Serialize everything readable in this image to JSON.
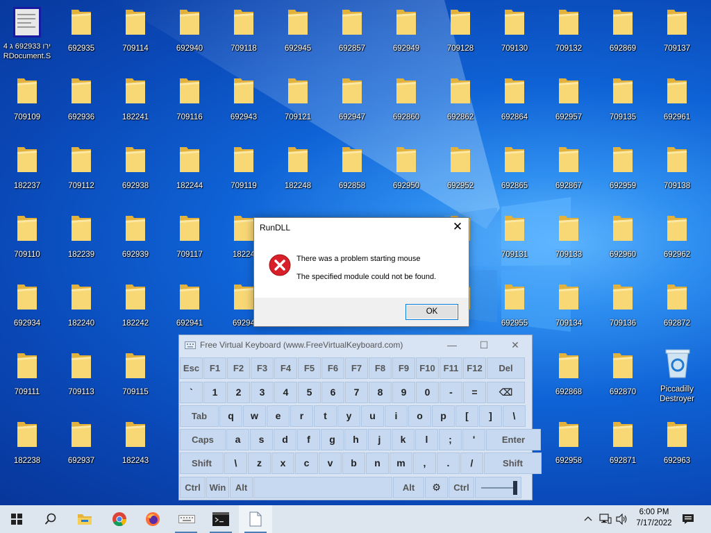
{
  "desktop": {
    "rows": [
      [
        "",
        "692935",
        "709114",
        "692940",
        "709118",
        "692945",
        "692857",
        "692949",
        "709128",
        "709130",
        "709132",
        "692869",
        "709137"
      ],
      [
        "709109",
        "692936",
        "182241",
        "709116",
        "692943",
        "709121",
        "692947",
        "692860",
        "692862",
        "692864",
        "692957",
        "709135",
        "692961"
      ],
      [
        "182237",
        "709112",
        "692938",
        "182244",
        "709119",
        "182248",
        "692858",
        "692950",
        "692952",
        "692865",
        "692867",
        "692959",
        "709138"
      ],
      [
        "709110",
        "182239",
        "692939",
        "709117",
        "18224",
        "",
        "",
        "",
        "3",
        "709131",
        "709133",
        "692960",
        "692962"
      ],
      [
        "692934",
        "182240",
        "182242",
        "692941",
        "69294",
        "",
        "",
        "",
        "9",
        "692955",
        "709134",
        "709136",
        "692872"
      ],
      [
        "709111",
        "709113",
        "709115",
        "",
        "",
        "",
        "",
        "",
        "",
        "",
        "692868",
        "692870",
        ""
      ],
      [
        "182238",
        "692937",
        "182243",
        "",
        "",
        "",
        "",
        "",
        "",
        "",
        "692958",
        "692871",
        "692963"
      ]
    ],
    "doc_icon_label": "ירו 692933 ג 4 RDocument.S",
    "recycle_label": "Piccadilly Destroyer"
  },
  "dialog": {
    "title": "RunDLL",
    "close": "✕",
    "message1": "There was a problem starting mouse",
    "message2": "The specified module could not be found.",
    "ok": "OK"
  },
  "vk": {
    "title": "Free Virtual Keyboard (www.FreeVirtualKeyboard.com)",
    "minimize": "—",
    "maximize": "☐",
    "close": "✕",
    "rows": [
      [
        "Esc",
        "F1",
        "F2",
        "F3",
        "F4",
        "F5",
        "F6",
        "F7",
        "F8",
        "F9",
        "F10",
        "F11",
        "F12",
        "Del"
      ],
      [
        "`",
        "1",
        "2",
        "3",
        "4",
        "5",
        "6",
        "7",
        "8",
        "9",
        "0",
        "-",
        "=",
        "⌫"
      ],
      [
        "Tab",
        "q",
        "w",
        "e",
        "r",
        "t",
        "y",
        "u",
        "i",
        "o",
        "p",
        "[",
        "]",
        "\\"
      ],
      [
        "Caps",
        "a",
        "s",
        "d",
        "f",
        "g",
        "h",
        "j",
        "k",
        "l",
        ";",
        "'",
        "Enter"
      ],
      [
        "Shift",
        "\\",
        "z",
        "x",
        "c",
        "v",
        "b",
        "n",
        "m",
        ",",
        ".",
        "/",
        "Shift"
      ],
      [
        "Ctrl",
        "Win",
        "Alt",
        "",
        "Alt",
        "⚙",
        "Ctrl",
        ""
      ]
    ]
  },
  "taskbar": {
    "time": "6:00 PM",
    "date": "7/17/2022"
  },
  "colors": {
    "desktop_blue": "#0a55c4",
    "error_red": "#e81123",
    "accent": "#0078d7",
    "folder_yellow": "#f3c94e"
  }
}
